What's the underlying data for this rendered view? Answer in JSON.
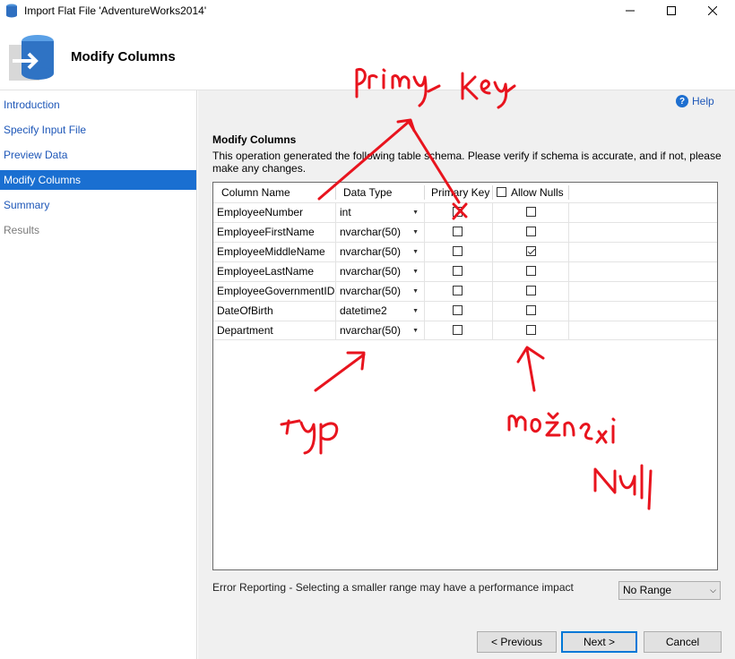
{
  "window": {
    "title": "Import Flat File 'AdventureWorks2014'",
    "controls": [
      "—",
      "☐",
      "✕"
    ]
  },
  "header": {
    "title": "Modify Columns"
  },
  "sidebar": {
    "items": [
      {
        "label": "Introduction",
        "state": "link"
      },
      {
        "label": "Specify Input File",
        "state": "link"
      },
      {
        "label": "Preview Data",
        "state": "link"
      },
      {
        "label": "Modify Columns",
        "state": "active"
      },
      {
        "label": "Summary",
        "state": "link"
      },
      {
        "label": "Results",
        "state": "disabled"
      }
    ]
  },
  "help": {
    "label": "Help",
    "icon": "help-icon"
  },
  "section": {
    "title": "Modify Columns",
    "description": "This operation generated the following table schema. Please verify if schema is accurate, and if not, please make any changes."
  },
  "grid": {
    "columns": [
      "Column Name",
      "Data Type",
      "Primary Key",
      "Allow Nulls"
    ],
    "allow_nulls_header_checked": false,
    "rows": [
      {
        "name": "EmployeeNumber",
        "type": "int",
        "pk": false,
        "nulls": false
      },
      {
        "name": "EmployeeFirstName",
        "type": "nvarchar(50)",
        "pk": false,
        "nulls": false
      },
      {
        "name": "EmployeeMiddleName",
        "type": "nvarchar(50)",
        "pk": false,
        "nulls": true
      },
      {
        "name": "EmployeeLastName",
        "type": "nvarchar(50)",
        "pk": false,
        "nulls": false
      },
      {
        "name": "EmployeeGovernmentID",
        "type": "nvarchar(50)",
        "pk": false,
        "nulls": false
      },
      {
        "name": "DateOfBirth",
        "type": "datetime2",
        "pk": false,
        "nulls": false
      },
      {
        "name": "Department",
        "type": "nvarchar(50)",
        "pk": false,
        "nulls": false
      }
    ]
  },
  "error_reporting": {
    "label": "Error Reporting - Selecting a smaller range may have a performance impact",
    "selected": "No Range"
  },
  "buttons": {
    "previous": "< Previous",
    "next": "Next >",
    "cancel": "Cancel"
  },
  "annotations": {
    "color": "#e8141e",
    "labels": [
      "Primary Key",
      "typ",
      "možnosti",
      "Null"
    ]
  }
}
